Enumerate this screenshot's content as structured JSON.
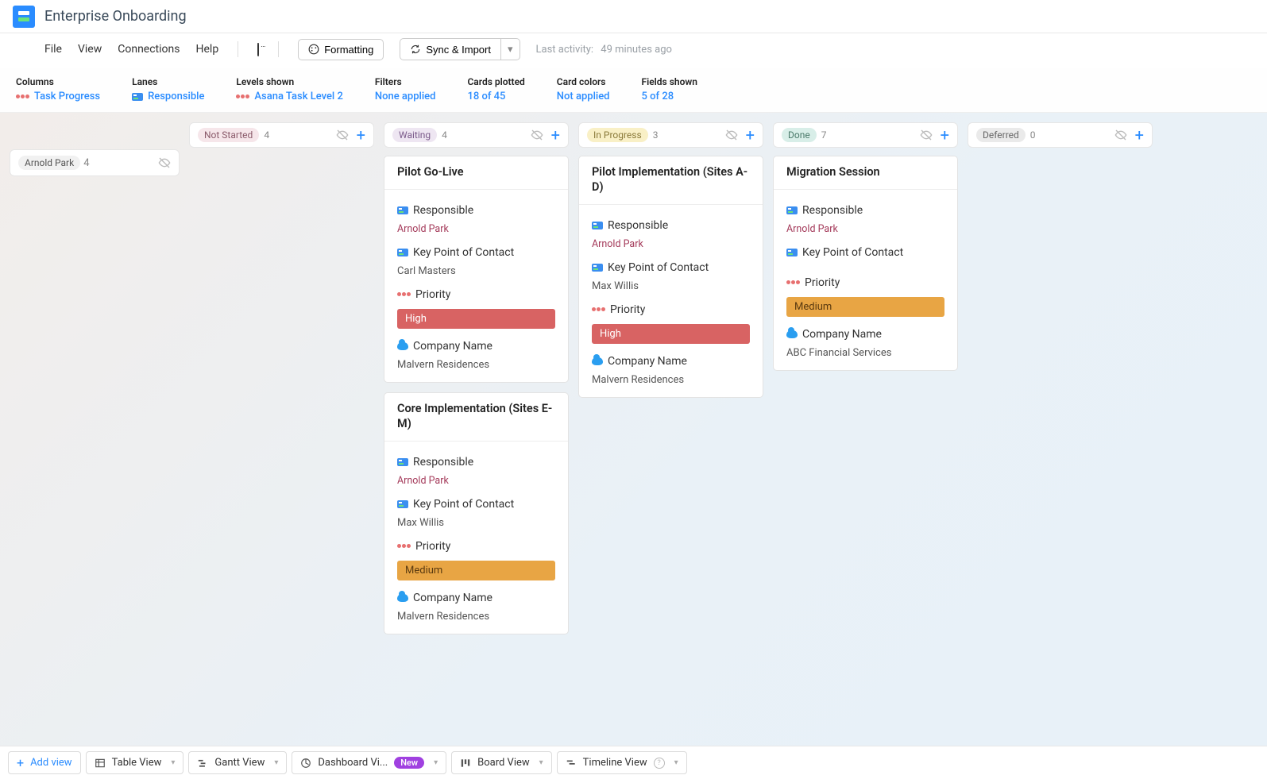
{
  "header": {
    "title": "Enterprise Onboarding",
    "menu": {
      "file": "File",
      "view": "View",
      "connections": "Connections",
      "help": "Help"
    },
    "buttons": {
      "formatting": "Formatting",
      "sync": "Sync & Import"
    },
    "activity": {
      "label": "Last activity:",
      "value": "49 minutes ago"
    }
  },
  "filters": {
    "columns": {
      "label": "Columns",
      "value": "Task Progress"
    },
    "lanes": {
      "label": "Lanes",
      "value": "Responsible"
    },
    "levels": {
      "label": "Levels shown",
      "value": "Asana Task Level 2"
    },
    "filters": {
      "label": "Filters",
      "value": "None applied"
    },
    "cards": {
      "label": "Cards plotted",
      "value": "18 of 45"
    },
    "colors": {
      "label": "Card colors",
      "value": "Not applied"
    },
    "fields": {
      "label": "Fields shown",
      "value": "5 of 28"
    }
  },
  "swimlane": {
    "name": "Arnold Park",
    "count": "4"
  },
  "columns": [
    {
      "name": "Not Started",
      "count": "4",
      "pill": "pill-pink"
    },
    {
      "name": "Waiting",
      "count": "4",
      "pill": "pill-purple"
    },
    {
      "name": "In Progress",
      "count": "3",
      "pill": "pill-yellow"
    },
    {
      "name": "Done",
      "count": "7",
      "pill": "pill-teal"
    },
    {
      "name": "Deferred",
      "count": "0",
      "pill": "pill-grey"
    }
  ],
  "fieldLabels": {
    "responsible": "Responsible",
    "contact": "Key Point of Contact",
    "priority": "Priority",
    "company": "Company Name"
  },
  "cards": {
    "waiting": [
      {
        "title": "Pilot Go-Live",
        "responsible": "Arnold Park",
        "contact": "Carl Masters",
        "priority": "High",
        "priorityClass": "prio-high",
        "company": "Malvern Residences"
      },
      {
        "title": "Core Implementation (Sites E-M)",
        "responsible": "Arnold Park",
        "contact": "Max Willis",
        "priority": "Medium",
        "priorityClass": "prio-med",
        "company": "Malvern Residences"
      }
    ],
    "inprogress": [
      {
        "title": "Pilot Implementation (Sites A-D)",
        "responsible": "Arnold Park",
        "contact": "Max Willis",
        "priority": "High",
        "priorityClass": "prio-high",
        "company": "Malvern Residences"
      }
    ],
    "done": [
      {
        "title": "Migration Session",
        "responsible": "Arnold Park",
        "contact": "",
        "priority": "Medium",
        "priorityClass": "prio-med",
        "company": "ABC Financial Services"
      }
    ]
  },
  "footer": {
    "addView": "Add view",
    "tabs": [
      {
        "label": "Table View"
      },
      {
        "label": "Gantt View"
      },
      {
        "label": "Dashboard Vi...",
        "new": "New"
      },
      {
        "label": "Board View"
      },
      {
        "label": "Timeline View",
        "help": true
      }
    ]
  }
}
